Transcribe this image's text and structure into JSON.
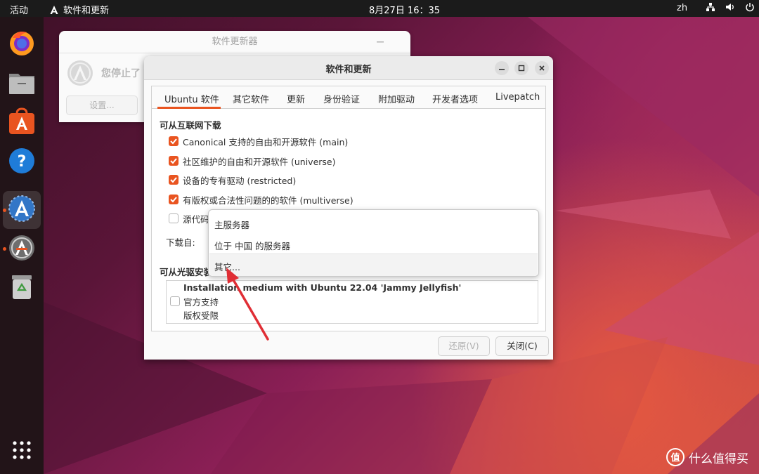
{
  "topbar": {
    "activities": "活动",
    "app_name": "软件和更新",
    "clock": "8月27日  16：35",
    "lang": "zh",
    "tray_icons": [
      "network-icon",
      "volume-icon",
      "power-icon"
    ]
  },
  "dock": {
    "items": [
      "firefox-icon",
      "files-icon",
      "software-store-icon",
      "help-icon",
      "software-updates-icon",
      "software-updater-icon",
      "trash-icon"
    ],
    "show_apps_icon": "app-grid-icon",
    "accent": "#e95420"
  },
  "updater_window": {
    "title": "软件更新器",
    "message": "您停止了",
    "settings_button": "设置..."
  },
  "dialog": {
    "title": "软件和更新",
    "tabs": [
      "Ubuntu 软件",
      "其它软件",
      "更新",
      "身份验证",
      "附加驱动",
      "开发者选项",
      "Livepatch"
    ],
    "active_tab": "Ubuntu 软件",
    "internet_section": "可从互联网下载",
    "checkboxes": [
      {
        "label": "Canonical 支持的自由和开源软件 (main)",
        "checked": true
      },
      {
        "label": "社区维护的自由和开源软件 (universe)",
        "checked": true
      },
      {
        "label": "设备的专有驱动 (restricted)",
        "checked": true
      },
      {
        "label": "有版权或合法性问题的的软件 (multiverse)",
        "checked": true
      },
      {
        "label": "源代码",
        "checked": false
      }
    ],
    "download_from_label": "下载自:",
    "cdrom_section": "可从光驱安装",
    "cdrom_item": {
      "title": "Installation medium with Ubuntu 22.04 'Jammy Jellyfish'",
      "line2": "官方支持",
      "line3": "版权受限",
      "checked": false
    },
    "revert_button": "还原(V)",
    "close_button": "关闭(C)"
  },
  "dropdown": {
    "options": [
      "主服务器",
      "位于 中国 的服务器",
      "其它..."
    ],
    "highlighted": "其它..."
  },
  "annotation": {
    "arrow_color": "#e02e35"
  },
  "watermark": {
    "text": "什么值得买",
    "logo": "值"
  }
}
